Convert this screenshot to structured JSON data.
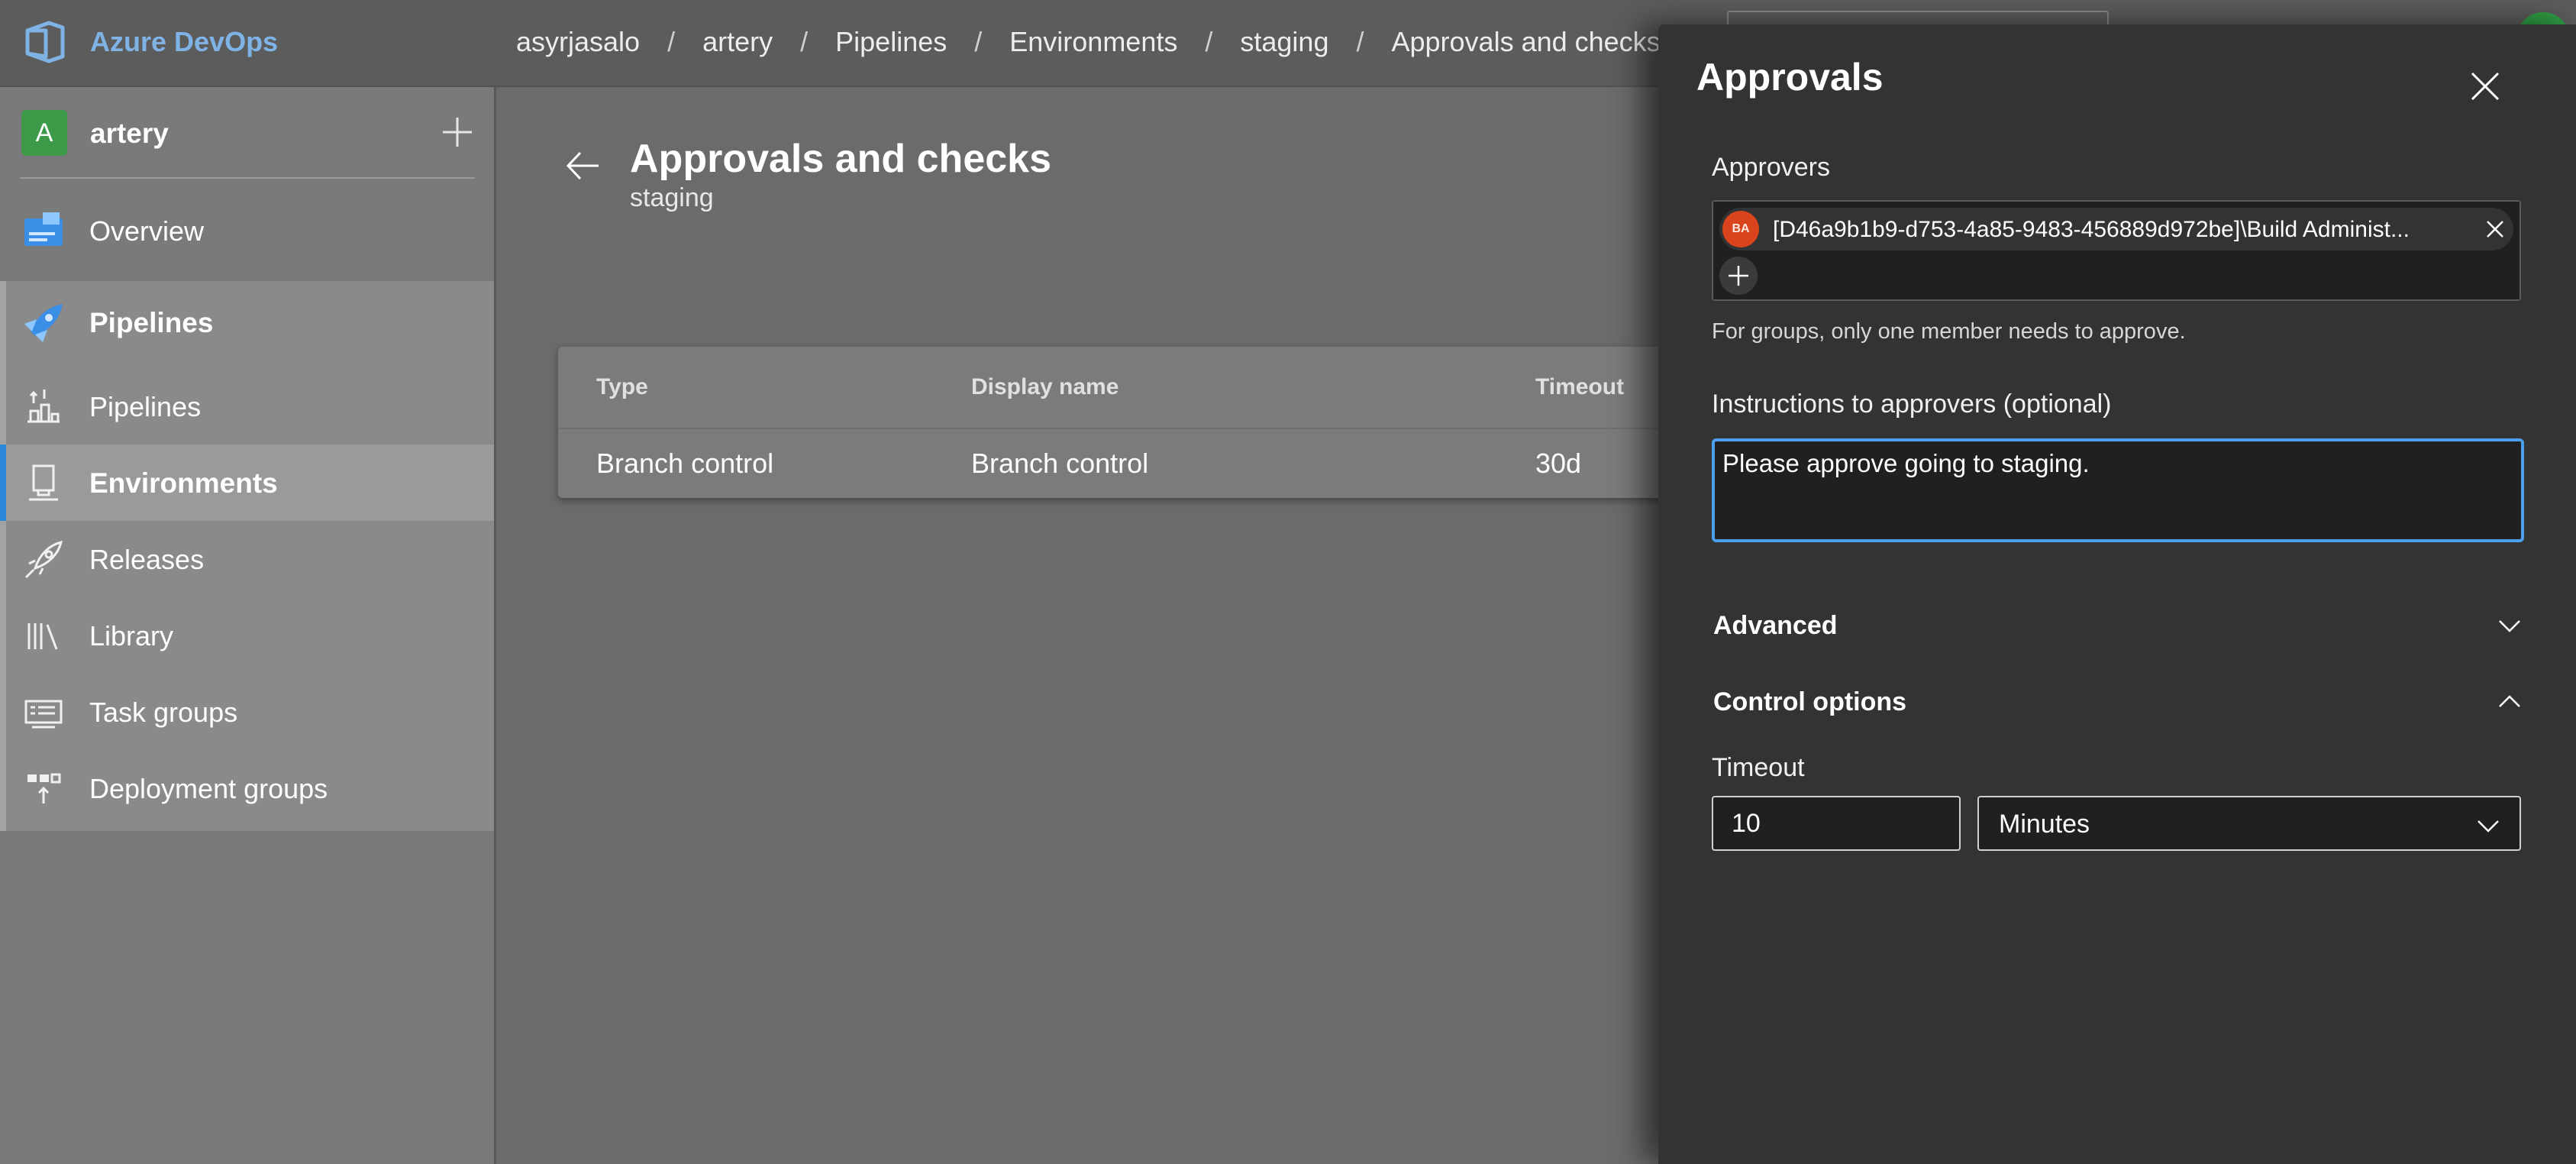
{
  "header": {
    "brand": "Azure DevOps",
    "breadcrumbs": [
      "asyrjasalo",
      "artery",
      "Pipelines",
      "Environments",
      "staging",
      "Approvals and checks"
    ],
    "separator": "/"
  },
  "sidebar": {
    "project": {
      "initial": "A",
      "name": "artery"
    },
    "items": [
      {
        "label": "Overview",
        "icon": "overview-icon"
      },
      {
        "label": "Pipelines",
        "icon": "pipelines-rocket-icon"
      },
      {
        "label": "Pipelines",
        "icon": "pipelines-icon"
      },
      {
        "label": "Environments",
        "icon": "environments-icon"
      },
      {
        "label": "Releases",
        "icon": "releases-icon"
      },
      {
        "label": "Library",
        "icon": "library-icon"
      },
      {
        "label": "Task groups",
        "icon": "task-groups-icon"
      },
      {
        "label": "Deployment groups",
        "icon": "deployment-groups-icon"
      }
    ],
    "selected": "Environments"
  },
  "main": {
    "title": "Approvals and checks",
    "subtitle": "staging",
    "table": {
      "columns": [
        "Type",
        "Display name",
        "Timeout"
      ],
      "rows": [
        {
          "type": "Branch control",
          "display_name": "Branch control",
          "timeout": "30d"
        }
      ]
    }
  },
  "panel": {
    "title": "Approvals",
    "approvers_label": "Approvers",
    "approver": {
      "initials": "BA",
      "name": "[D46a9b1b9-d753-4a85-9483-456889d972be]\\Build Administ..."
    },
    "approvers_hint": "For groups, only one member needs to approve.",
    "instructions_label": "Instructions to approvers (optional)",
    "instructions_value": "Please approve going to staging.",
    "advanced_label": "Advanced",
    "advanced_expanded": false,
    "control_options_label": "Control options",
    "control_options_expanded": true,
    "timeout_label": "Timeout",
    "timeout_value": "10",
    "timeout_unit": "Minutes"
  },
  "colors": {
    "accent": "#4aa0ee",
    "brand_text": "#7fb3e6",
    "project_avatar": "#3c9a49",
    "approver_avatar": "#d9441c"
  }
}
